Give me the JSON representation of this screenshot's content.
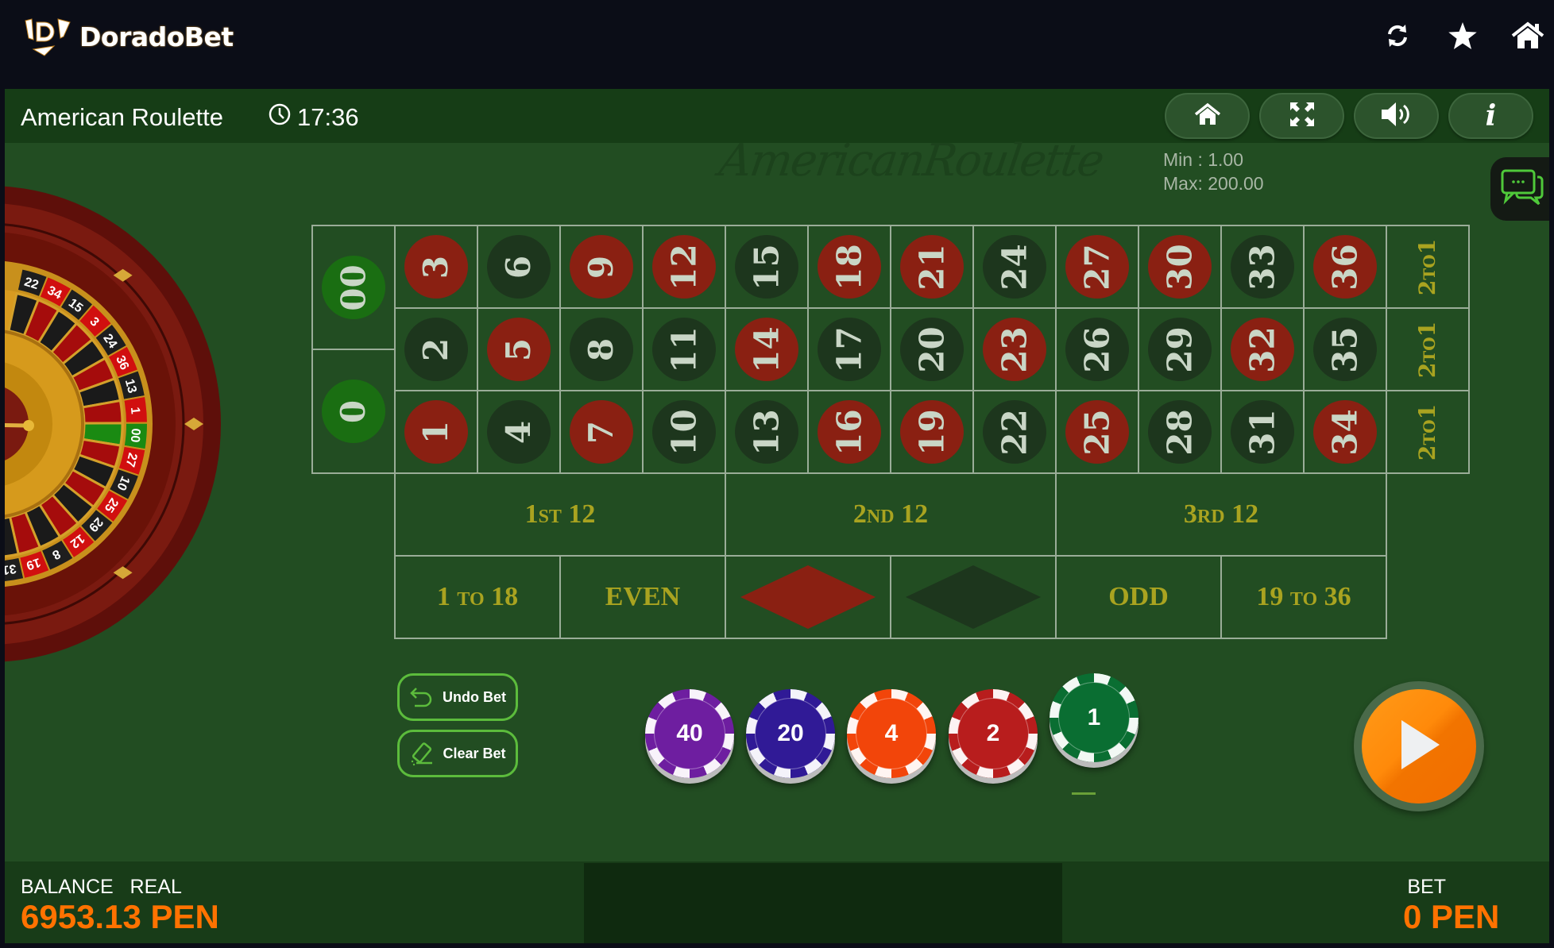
{
  "site": {
    "brand": "DoradoBet",
    "top_icons": [
      "refresh-icon",
      "star-icon",
      "home-icon"
    ]
  },
  "game": {
    "title": "American Roulette",
    "clock": "17:36",
    "watermark": "AmericanRoulette",
    "header_buttons": [
      "home-icon",
      "fullscreen-icon",
      "sound-icon",
      "info-icon"
    ],
    "limits": {
      "min": "Min : 1.00",
      "max": "Max: 200.00"
    }
  },
  "wheel": {
    "visible_numbers": [
      "22",
      "34",
      "15",
      "3",
      "24",
      "36",
      "13",
      "1",
      "00",
      "27",
      "10",
      "25",
      "29",
      "12",
      "8",
      "19",
      "31"
    ]
  },
  "table": {
    "zeros": [
      "00",
      "0"
    ],
    "columns": [
      {
        "top": "3",
        "mid": "2",
        "bot": "1"
      },
      {
        "top": "6",
        "mid": "5",
        "bot": "4"
      },
      {
        "top": "9",
        "mid": "8",
        "bot": "7"
      },
      {
        "top": "12",
        "mid": "11",
        "bot": "10"
      },
      {
        "top": "15",
        "mid": "14",
        "bot": "13"
      },
      {
        "top": "18",
        "mid": "17",
        "bot": "16"
      },
      {
        "top": "21",
        "mid": "20",
        "bot": "19"
      },
      {
        "top": "24",
        "mid": "23",
        "bot": "22"
      },
      {
        "top": "27",
        "mid": "26",
        "bot": "25"
      },
      {
        "top": "30",
        "mid": "29",
        "bot": "28"
      },
      {
        "top": "33",
        "mid": "32",
        "bot": "31"
      },
      {
        "top": "36",
        "mid": "35",
        "bot": "34"
      }
    ],
    "red_numbers": [
      "1",
      "3",
      "5",
      "7",
      "9",
      "12",
      "14",
      "16",
      "18",
      "19",
      "21",
      "23",
      "25",
      "27",
      "30",
      "32",
      "34",
      "36"
    ],
    "column_bets": [
      "2to1",
      "2to1",
      "2to1"
    ],
    "dozens": [
      "1st 12",
      "2nd 12",
      "3rd 12"
    ],
    "outside": {
      "low": "1 to 18",
      "even": "EVEN",
      "red": "red-diamond",
      "black": "black-diamond",
      "odd": "ODD",
      "high": "19 to 36"
    },
    "colors": {
      "red": "#8a2012",
      "black": "#1d361d",
      "green": "#1a6e12",
      "felt": "#224d22",
      "label": "#a9a320"
    }
  },
  "actions": {
    "undo": "Undo Bet",
    "clear": "Clear Bet",
    "play": "play-icon"
  },
  "chips": [
    {
      "value": "40",
      "color": "#6e1ea0"
    },
    {
      "value": "20",
      "color": "#301a96"
    },
    {
      "value": "4",
      "color": "#f2450a"
    },
    {
      "value": "2",
      "color": "#b81d1d"
    },
    {
      "value": "1",
      "color": "#0a6e32",
      "selected": true
    }
  ],
  "footer": {
    "balance_label": "BALANCE   REAL",
    "balance_value": "6953.13 PEN",
    "bet_label": "BET",
    "bet_value": "0 PEN"
  }
}
